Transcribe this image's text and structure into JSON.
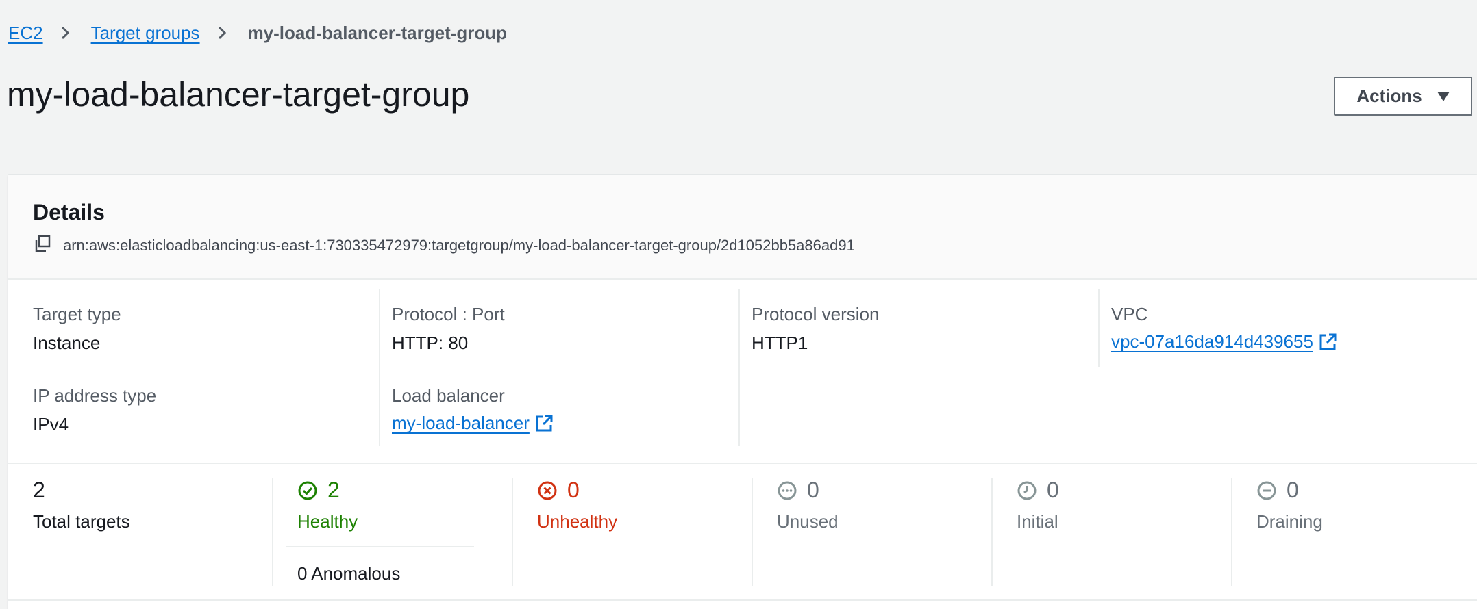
{
  "breadcrumb": {
    "items": [
      {
        "label": "EC2"
      },
      {
        "label": "Target groups"
      }
    ],
    "current": "my-load-balancer-target-group"
  },
  "page_title": "my-load-balancer-target-group",
  "actions_label": "Actions",
  "details": {
    "title": "Details",
    "arn": "arn:aws:elasticloadbalancing:us-east-1:730335472979:targetgroup/my-load-balancer-target-group/2d1052bb5a86ad91",
    "fields": {
      "target_type": {
        "label": "Target type",
        "value": "Instance"
      },
      "protocol_port": {
        "label": "Protocol : Port",
        "value": "HTTP: 80"
      },
      "protocol_version": {
        "label": "Protocol version",
        "value": "HTTP1"
      },
      "vpc": {
        "label": "VPC",
        "value": "vpc-07a16da914d439655"
      },
      "ip_address_type": {
        "label": "IP address type",
        "value": "IPv4"
      },
      "load_balancer": {
        "label": "Load balancer",
        "value": "my-load-balancer"
      }
    }
  },
  "targets": {
    "total": {
      "count": "2",
      "label": "Total targets"
    },
    "healthy": {
      "count": "2",
      "label": "Healthy",
      "color": "#1d8102"
    },
    "anomalous": "0 Anomalous",
    "unhealthy": {
      "count": "0",
      "label": "Unhealthy",
      "color": "#d13212"
    },
    "unused": {
      "count": "0",
      "label": "Unused",
      "color": "#687078"
    },
    "initial": {
      "count": "0",
      "label": "Initial",
      "color": "#687078"
    },
    "draining": {
      "count": "0",
      "label": "Draining",
      "color": "#687078"
    }
  },
  "colors": {
    "link": "#0972d3",
    "background": "#f2f3f3"
  }
}
